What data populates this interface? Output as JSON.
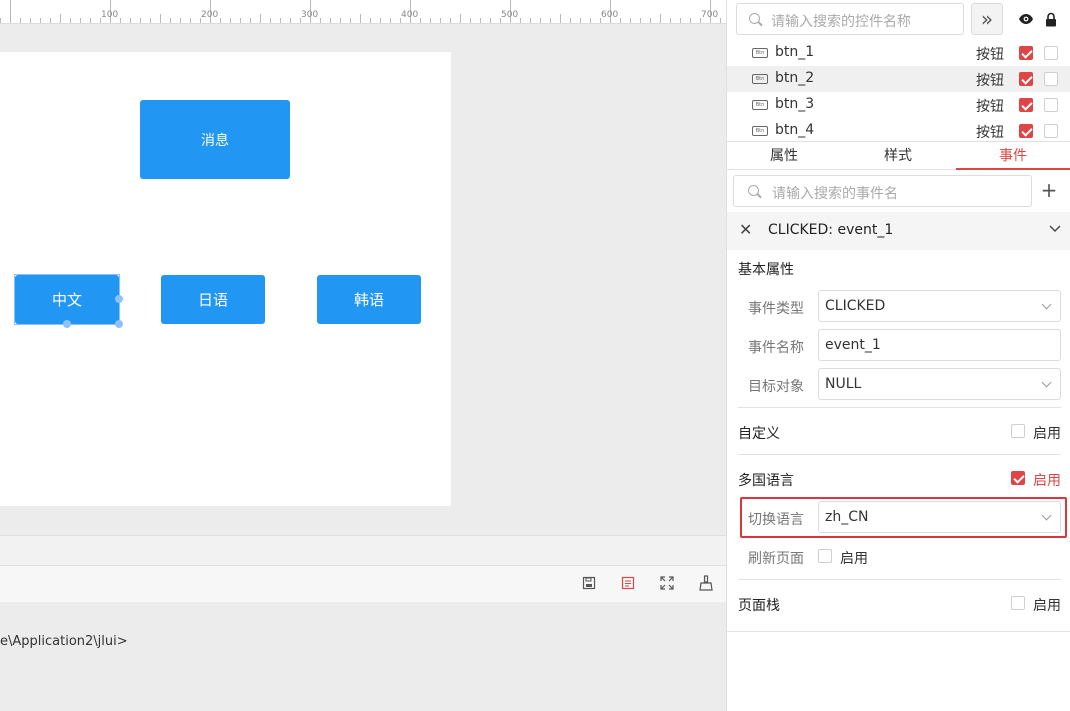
{
  "ruler": {
    "labels": [
      "100",
      "200",
      "300",
      "400",
      "500",
      "600",
      "700"
    ]
  },
  "canvas_buttons": {
    "message": "消息",
    "chinese": "中文",
    "japanese": "日语",
    "korean": "韩语"
  },
  "console": {
    "path": "e\\Application2\\jlui>"
  },
  "toolbar_icons": [
    "save-icon",
    "code-icon",
    "fullscreen-icon",
    "clean-icon"
  ],
  "widget_panel": {
    "search_placeholder": "请输入搜索的控件名称",
    "expand_icon": "»",
    "items": [
      {
        "name": "btn_1",
        "type": "按钮",
        "visible": true,
        "locked": false,
        "icon": "Btn"
      },
      {
        "name": "btn_2",
        "type": "按钮",
        "visible": true,
        "locked": false,
        "icon": "Btn",
        "selected": true
      },
      {
        "name": "btn_3",
        "type": "按钮",
        "visible": true,
        "locked": false,
        "icon": "Btn"
      },
      {
        "name": "btn_4",
        "type": "按钮",
        "visible": true,
        "locked": false,
        "icon": "Btn"
      }
    ]
  },
  "tabs": [
    {
      "label": "属性",
      "active": false
    },
    {
      "label": "样式",
      "active": false
    },
    {
      "label": "事件",
      "active": true
    }
  ],
  "events": {
    "search_placeholder": "请输入搜索的事件名",
    "add_label": "+",
    "event_title": "CLICKED: event_1",
    "basic_section": "基本属性",
    "event_type_label": "事件类型",
    "event_type_value": "CLICKED",
    "event_name_label": "事件名称",
    "event_name_value": "event_1",
    "target_label": "目标对象",
    "target_value": "NULL",
    "custom_label": "自定义",
    "custom_enable": "启用",
    "custom_enabled": false,
    "i18n_label": "多国语言",
    "i18n_enable": "启用",
    "i18n_enabled": true,
    "switch_lang_label": "切换语言",
    "switch_lang_value": "zh_CN",
    "refresh_label": "刷新页面",
    "refresh_enable": "启用",
    "refresh_enabled": false,
    "page_stack_label": "页面栈",
    "page_stack_enable": "启用",
    "page_stack_enabled": false
  },
  "colors": {
    "accent": "#e04545",
    "button_blue": "#2196f3",
    "highlight_red": "#d9363e"
  }
}
